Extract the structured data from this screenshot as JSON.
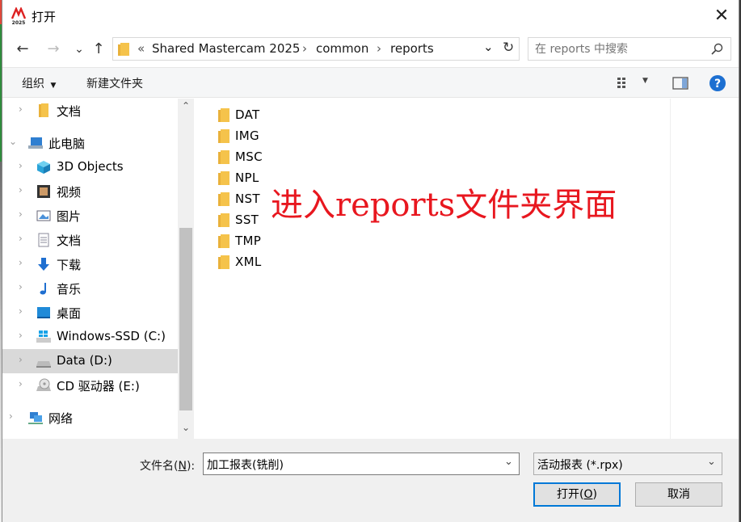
{
  "window": {
    "title": "打开",
    "close_glyph": "✕",
    "logo_text": "2025"
  },
  "nav": {
    "back": "←",
    "forward": "→",
    "recent": "⌄",
    "up": "↑",
    "refresh": "↻"
  },
  "address": {
    "overflow": "«",
    "segments": [
      "Shared Mastercam 2025",
      "common",
      "reports"
    ],
    "separator": "›",
    "dropdown": "⌄"
  },
  "search": {
    "placeholder": "在 reports 中搜索"
  },
  "toolbar": {
    "organize": "组织",
    "new_folder": "新建文件夹"
  },
  "tree": [
    {
      "label": "文档",
      "icon": "folder-icon",
      "indent": 1,
      "expanded": false
    },
    {
      "label": "此电脑",
      "icon": "computer-icon",
      "indent": 0,
      "expanded": true
    },
    {
      "label": "3D Objects",
      "icon": "cube-icon",
      "indent": 1,
      "expanded": false
    },
    {
      "label": "视频",
      "icon": "video-icon",
      "indent": 1,
      "expanded": false
    },
    {
      "label": "图片",
      "icon": "picture-icon",
      "indent": 1,
      "expanded": false
    },
    {
      "label": "文档",
      "icon": "document-icon",
      "indent": 1,
      "expanded": false
    },
    {
      "label": "下载",
      "icon": "download-icon",
      "indent": 1,
      "expanded": false
    },
    {
      "label": "音乐",
      "icon": "music-icon",
      "indent": 1,
      "expanded": false
    },
    {
      "label": "桌面",
      "icon": "desktop-icon",
      "indent": 1,
      "expanded": false
    },
    {
      "label": "Windows-SSD (C:)",
      "icon": "windows-drive-icon",
      "indent": 1,
      "expanded": false
    },
    {
      "label": "Data (D:)",
      "icon": "drive-icon",
      "indent": 1,
      "expanded": false,
      "selected": true
    },
    {
      "label": "CD 驱动器 (E:)",
      "icon": "cd-drive-icon",
      "indent": 1,
      "expanded": false
    },
    {
      "label": "网络",
      "icon": "network-icon",
      "indent": 0,
      "expanded": false
    }
  ],
  "folders": [
    "DAT",
    "IMG",
    "MSC",
    "NPL",
    "NST",
    "SST",
    "TMP",
    "XML"
  ],
  "annotation": "进入reports文件夹界面",
  "bottom": {
    "filename_label": "文件名(",
    "filename_key": "N",
    "filename_label_end": "):",
    "filename_value": "加工报表(铣削)",
    "filetype_value": "活动报表 (*.rpx)",
    "open_label": "打开(",
    "open_key": "O",
    "open_label_end": ")",
    "cancel_label": "取消"
  },
  "colors": {
    "accent": "#0078d7",
    "annotation": "#e8171f",
    "folder": "#f5c34b"
  }
}
